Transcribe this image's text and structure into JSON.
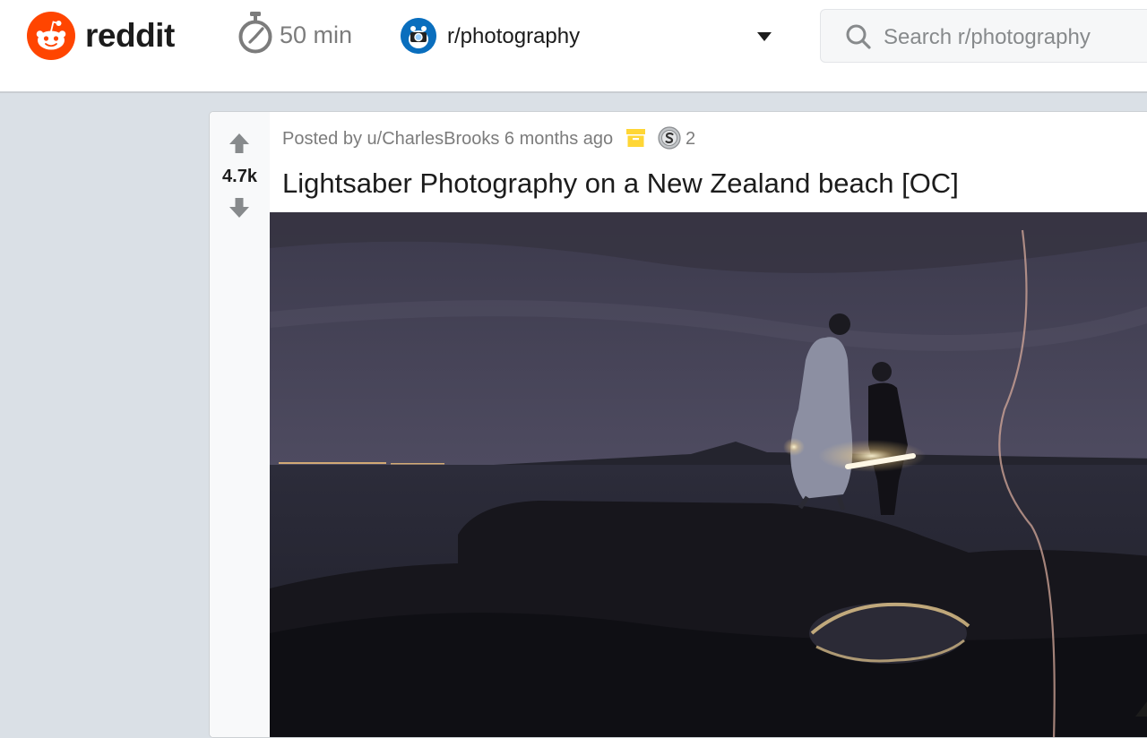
{
  "header": {
    "brand": "reddit",
    "timer_text": "50 min",
    "subreddit": "r/photography",
    "search_placeholder": "Search r/photography"
  },
  "post": {
    "score": "4.7k",
    "posted_by_prefix": "Posted by",
    "author": "u/CharlesBrooks",
    "age": "6 months ago",
    "award_count": "2",
    "title": "Lightsaber Photography on a New Zealand beach [OC]"
  },
  "colors": {
    "brand": "#ff4500",
    "page_background": "#dae0e6",
    "archive_badge": "#ffd635",
    "vote_arrow": "#878a8c"
  },
  "icons": [
    "reddit-logo",
    "stopwatch-icon",
    "subreddit-avatar",
    "chevron-down-icon",
    "search-icon",
    "upvote-arrow-icon",
    "downvote-arrow-icon",
    "archive-icon",
    "silver-award-icon"
  ]
}
